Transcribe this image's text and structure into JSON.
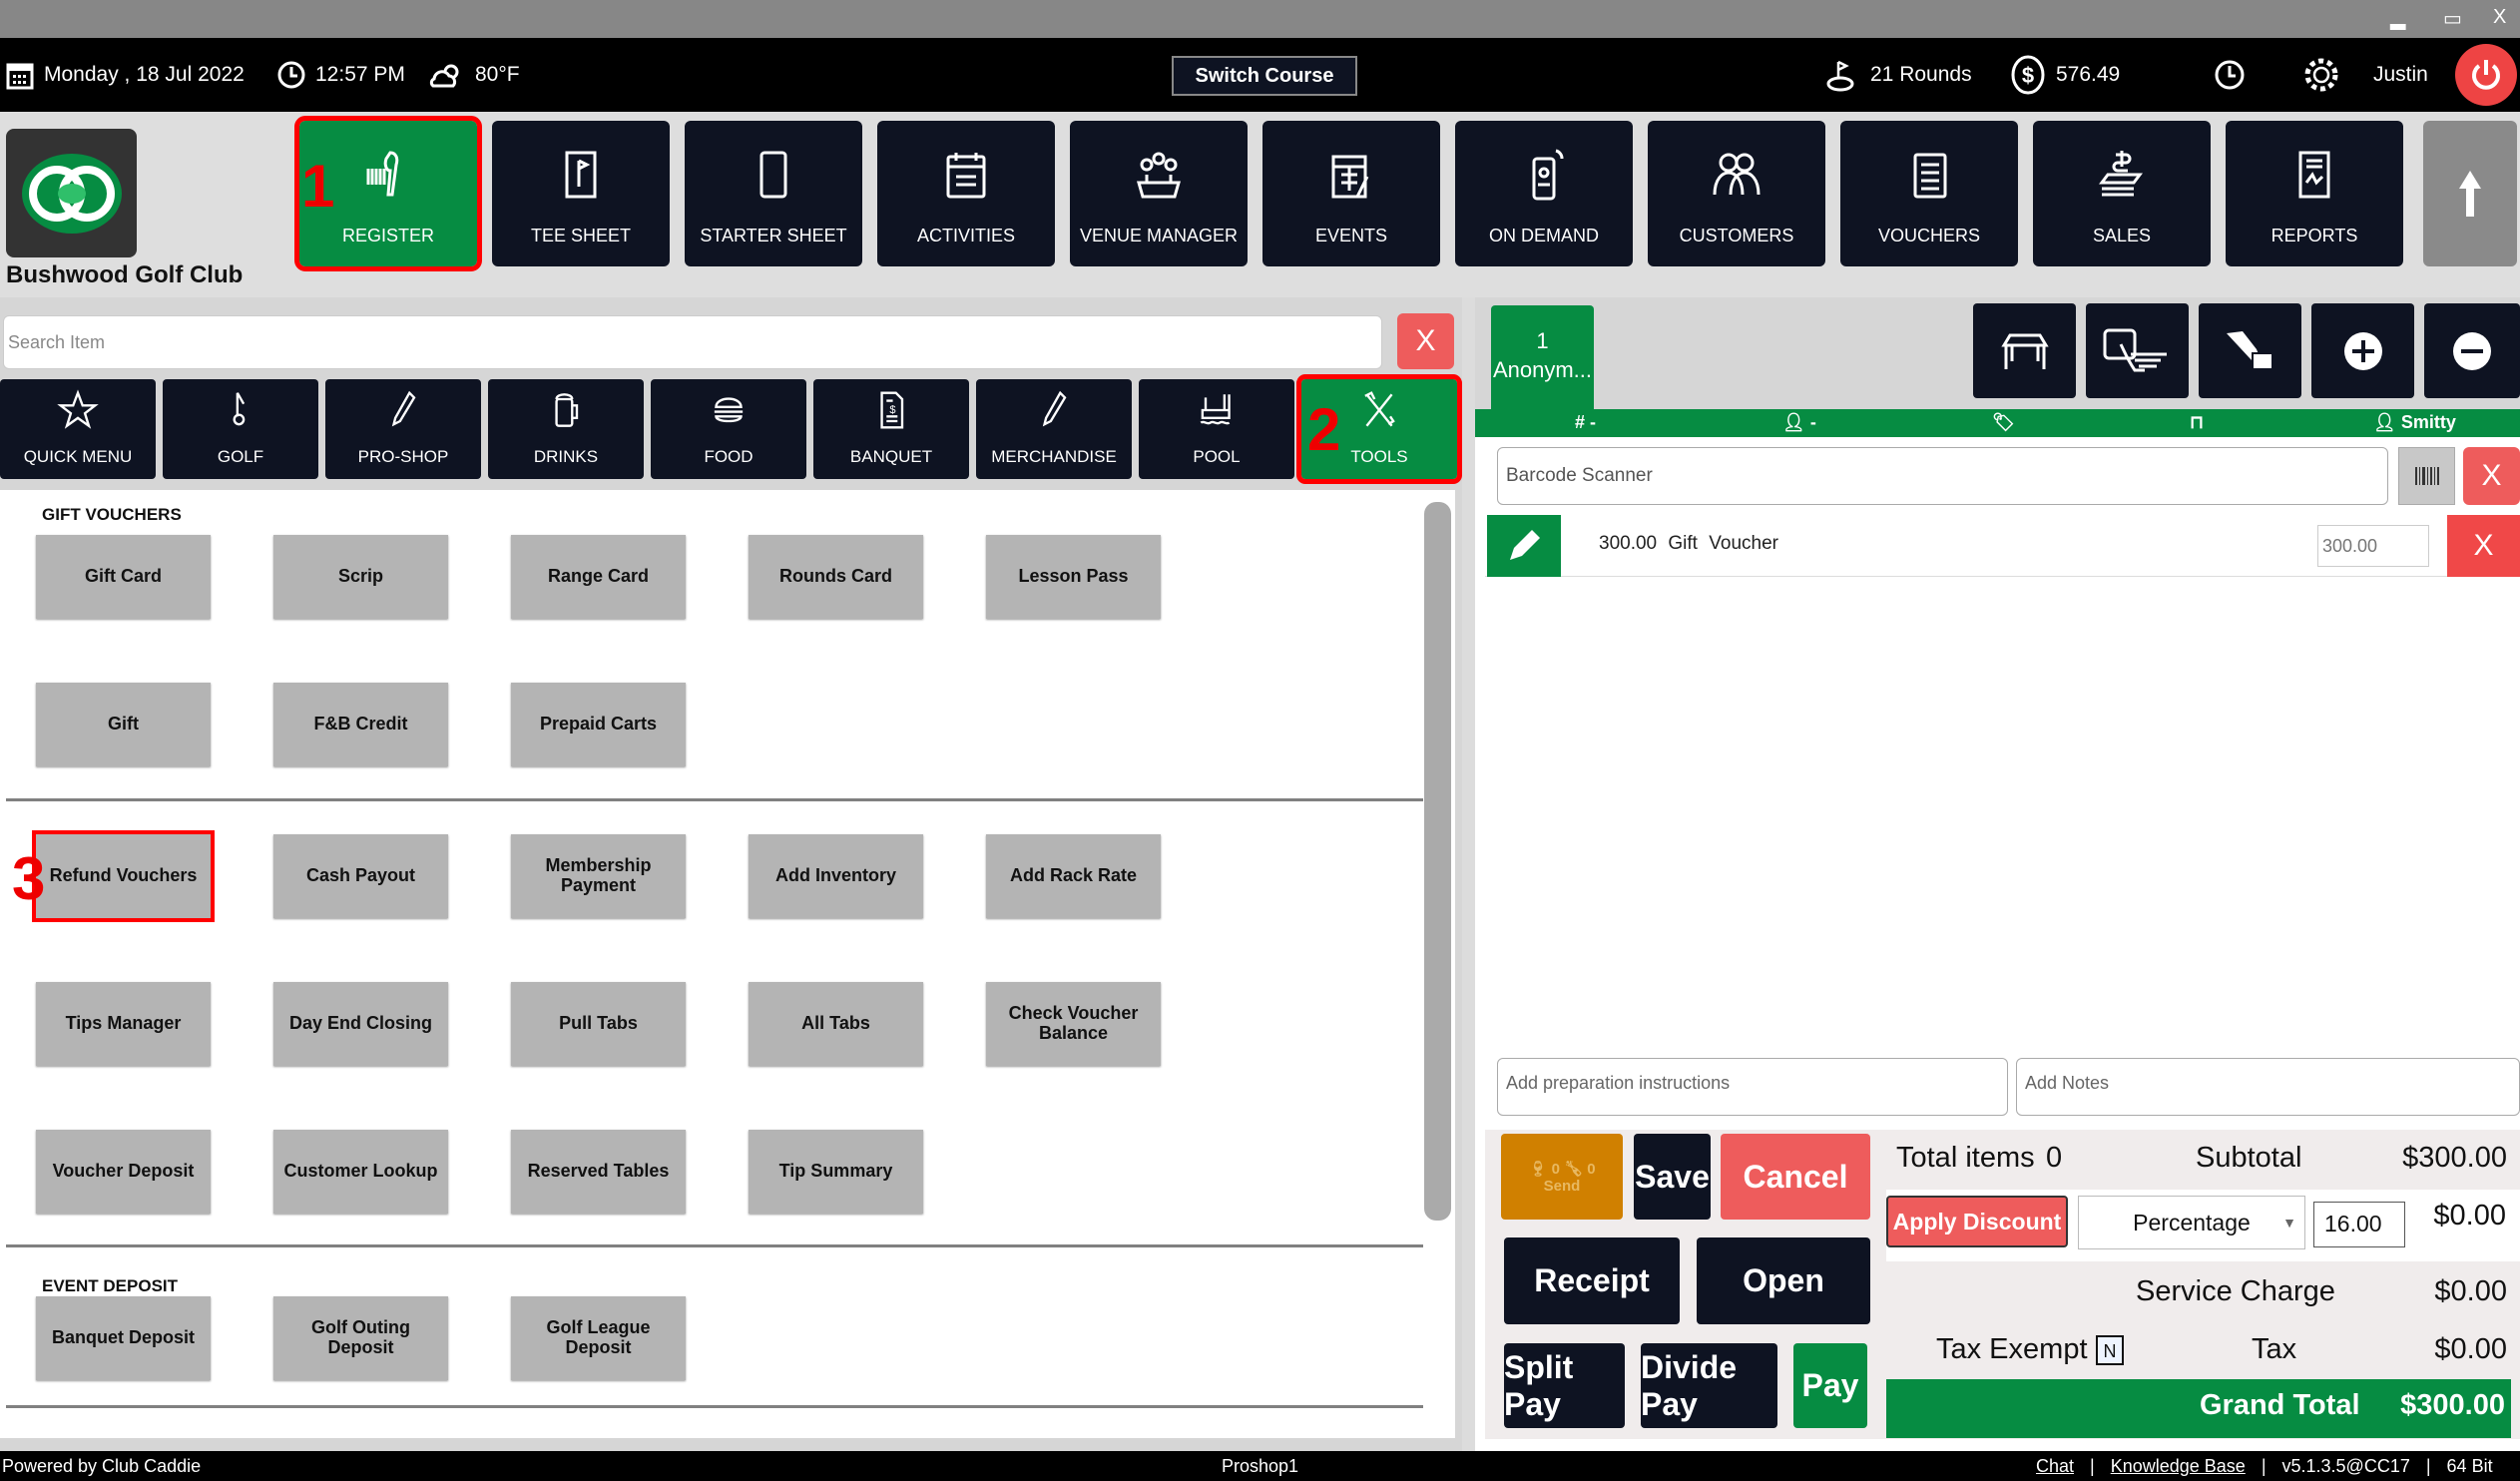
{
  "window": {
    "controls": [
      "▂",
      "▭",
      "X"
    ]
  },
  "topbar": {
    "date": "Monday ,  18 Jul 2022",
    "time": "12:57 PM",
    "weather": "80°F",
    "switch_course": "Switch Course",
    "rounds": "21 Rounds",
    "balance": "576.49",
    "user": "Justin"
  },
  "club_name": "Bushwood Golf Club",
  "nav": [
    {
      "label": "REGISTER",
      "icon": "barcode-scanner"
    },
    {
      "label": "TEE SHEET",
      "icon": "tee-sheet"
    },
    {
      "label": "STARTER SHEET",
      "icon": "tablet"
    },
    {
      "label": "ACTIVITIES",
      "icon": "calendar-list"
    },
    {
      "label": "VENUE MANAGER",
      "icon": "meeting"
    },
    {
      "label": "EVENTS",
      "icon": "calendar-edit"
    },
    {
      "label": "ON DEMAND",
      "icon": "mobile"
    },
    {
      "label": "CUSTOMERS",
      "icon": "users"
    },
    {
      "label": "VOUCHERS",
      "icon": "document"
    },
    {
      "label": "SALES",
      "icon": "money"
    },
    {
      "label": "REPORTS",
      "icon": "report"
    }
  ],
  "annotations": [
    "1",
    "2",
    "3"
  ],
  "search": {
    "placeholder": "Search Item",
    "clear": "X"
  },
  "categories": [
    {
      "label": "QUICK MENU"
    },
    {
      "label": "GOLF"
    },
    {
      "label": "PRO-SHOP"
    },
    {
      "label": "DRINKS"
    },
    {
      "label": "FOOD"
    },
    {
      "label": "BANQUET"
    },
    {
      "label": "MERCHANDISE"
    },
    {
      "label": "POOL"
    },
    {
      "label": "TOOLS"
    }
  ],
  "sections": [
    {
      "title": "GIFT VOUCHERS",
      "rows": [
        [
          "Gift Card",
          "Scrip",
          "Range Card",
          "Rounds Card",
          "Lesson Pass"
        ],
        [
          "Gift",
          "F&B Credit",
          "Prepaid Carts"
        ]
      ]
    },
    {
      "title": "",
      "rows": [
        [
          "Refund Vouchers",
          "Cash Payout",
          "Membership Payment",
          "Add Inventory",
          "Add Rack Rate"
        ],
        [
          "Tips Manager",
          "Day End Closing",
          "Pull Tabs",
          "All Tabs",
          "Check Voucher Balance"
        ],
        [
          "Voucher Deposit",
          "Customer Lookup",
          "Reserved Tables",
          "Tip Summary"
        ]
      ]
    },
    {
      "title": "EVENT DEPOSIT",
      "rows": [
        [
          "Banquet Deposit",
          "Golf Outing Deposit",
          "Golf League Deposit"
        ]
      ]
    },
    {
      "title": "EVENT FINAL PAYMENT",
      "rows": []
    }
  ],
  "order": {
    "tab_number": "1",
    "tab_name": "Anonym...",
    "strip": {
      "number": "-",
      "customer": "-",
      "server": "Smitty"
    },
    "barcode_placeholder": "Barcode Scanner",
    "clear": "X",
    "line_items": [
      {
        "qty": "300.00",
        "name1": "Gift",
        "name2": "Voucher",
        "price": "300.00"
      }
    ],
    "prep_placeholder": "Add preparation instructions",
    "notes_placeholder": "Add Notes"
  },
  "actions": {
    "send_label": "Send",
    "send_count1": "0",
    "send_count2": "0",
    "save": "Save",
    "cancel": "Cancel",
    "receipt": "Receipt",
    "open": "Open",
    "split_pay": "Split Pay",
    "divide_pay": "Divide Pay",
    "pay": "Pay"
  },
  "totals": {
    "total_items_label": "Total items",
    "total_items": "0",
    "subtotal_label": "Subtotal",
    "subtotal": "$300.00",
    "apply_discount": "Apply Discount",
    "discount_type": "Percentage",
    "discount_value": "16.00",
    "discount_amount": "$0.00",
    "service_charge_label": "Service Charge",
    "service_charge": "$0.00",
    "tax_exempt_label": "Tax Exempt",
    "tax_exempt_value": "N",
    "tax_label": "Tax",
    "tax": "$0.00",
    "grand_total_label": "Grand Total",
    "grand_total": "$300.00"
  },
  "footer": {
    "powered": "Powered by Club Caddie",
    "station": "Proshop1",
    "chat": "Chat",
    "kb": "Knowledge Base",
    "version": "v5.1.3.5@CC17",
    "bits": "64 Bit",
    "sep": "|"
  },
  "colors": {
    "green": "#068c42",
    "navy": "#0e1322",
    "red": "#ee5c5c",
    "orange": "#d08000"
  }
}
